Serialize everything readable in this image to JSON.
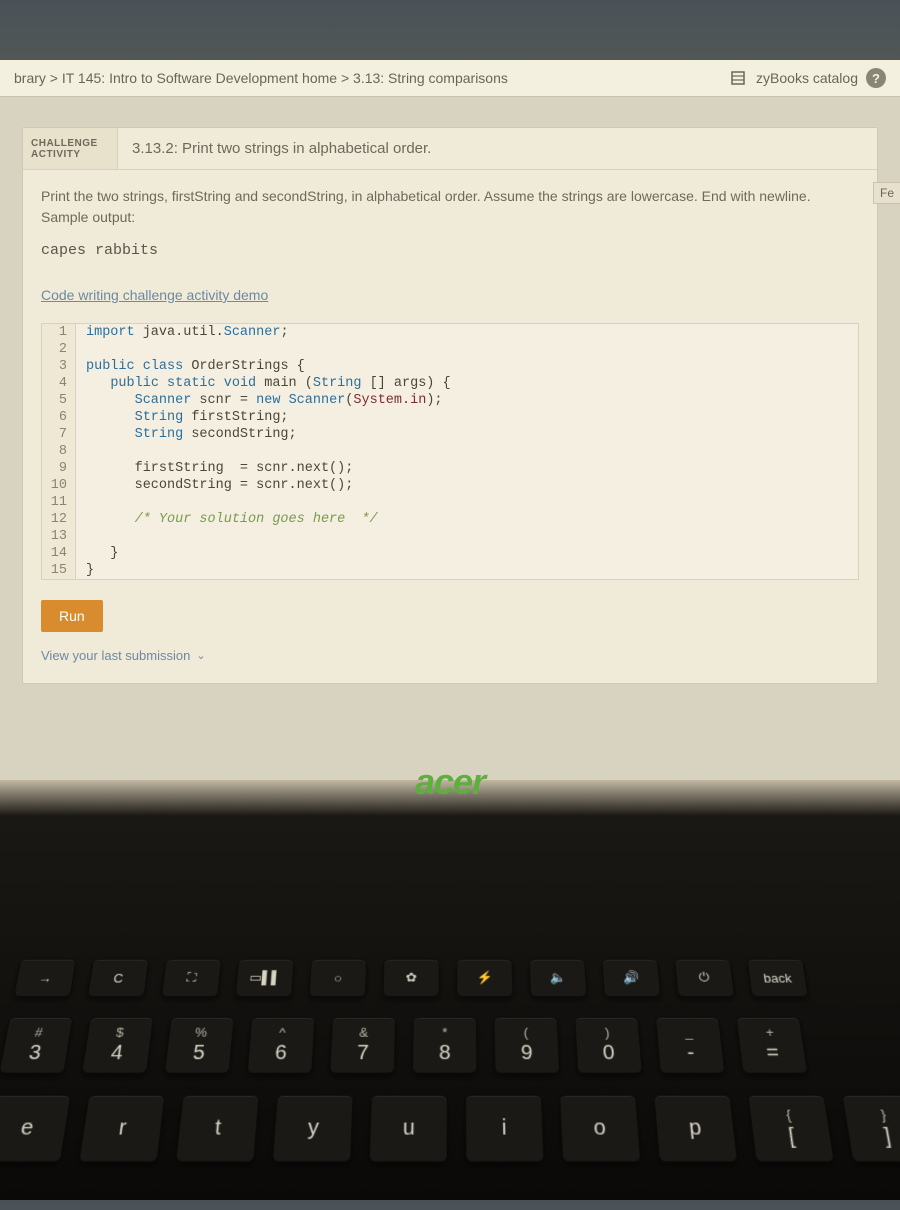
{
  "breadcrumb": "brary > IT 145: Intro to Software Development home > 3.13: String comparisons",
  "catalog_label": "zyBooks catalog",
  "help_glyph": "?",
  "feedback_label": "Fe",
  "badge": {
    "line1": "CHALLENGE",
    "line2": "ACTIVITY"
  },
  "activity_title": "3.13.2: Print two strings in alphabetical order.",
  "instructions": "Print the two strings, firstString and secondString, in alphabetical order. Assume the strings are lowercase. End with newline.",
  "sample_label": "Sample output:",
  "sample_output": "capes rabbits",
  "demo_link": "Code writing challenge activity demo",
  "code_lines": [
    "import java.util.Scanner;",
    "",
    "public class OrderStrings {",
    "   public static void main (String [] args) {",
    "      Scanner scnr = new Scanner(System.in);",
    "      String firstString;",
    "      String secondString;",
    "",
    "      firstString  = scnr.next();",
    "      secondString = scnr.next();",
    "",
    "      /* Your solution goes here  */",
    "",
    "   }",
    "}"
  ],
  "run_label": "Run",
  "view_submission": "View your last submission",
  "laptop_brand": "acer",
  "fn_keys": [
    "→",
    "C",
    "⛶",
    "▭▌▌",
    "○",
    "✿",
    "⚡",
    "🔈",
    "🔊",
    "⏻"
  ],
  "back_key": "back",
  "num_row": [
    {
      "upper": "#",
      "lower": "3"
    },
    {
      "upper": "$",
      "lower": "4"
    },
    {
      "upper": "%",
      "lower": "5"
    },
    {
      "upper": "^",
      "lower": "6"
    },
    {
      "upper": "&",
      "lower": "7"
    },
    {
      "upper": "*",
      "lower": "8"
    },
    {
      "upper": "(",
      "lower": "9"
    },
    {
      "upper": ")",
      "lower": "0"
    },
    {
      "upper": "_",
      "lower": "-"
    },
    {
      "upper": "+",
      "lower": "="
    }
  ],
  "alpha_row": [
    {
      "lower": "e"
    },
    {
      "lower": "r"
    },
    {
      "lower": "t"
    },
    {
      "lower": "y"
    },
    {
      "lower": "u"
    },
    {
      "lower": "i"
    },
    {
      "lower": "o"
    },
    {
      "lower": "p"
    },
    {
      "upper": "{",
      "lower": "["
    },
    {
      "upper": "}",
      "lower": "]"
    }
  ]
}
